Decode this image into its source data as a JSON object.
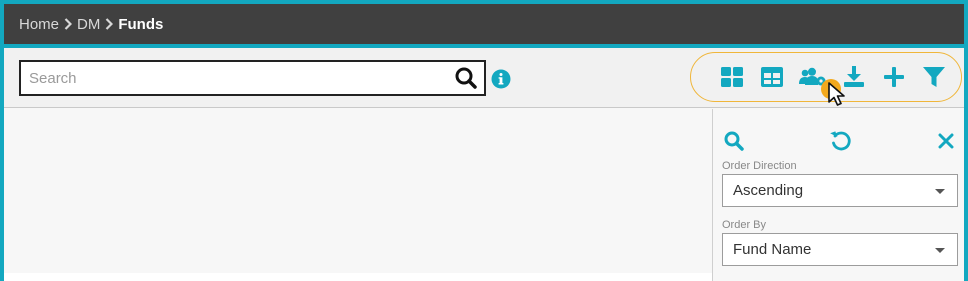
{
  "breadcrumb": {
    "items": [
      "Home",
      "DM"
    ],
    "current": "Funds"
  },
  "search": {
    "placeholder": "Search",
    "value": ""
  },
  "icons": {
    "search": "search-icon",
    "info": "info-icon",
    "grid_view": "grid-view-icon",
    "table_view": "table-view-icon",
    "group_settings": "group-settings-icon",
    "download": "download-icon",
    "add": "plus-icon",
    "filter": "filter-icon",
    "panel_search": "search-icon",
    "reset": "reset-icon",
    "close": "close-icon"
  },
  "filter_panel": {
    "order_direction": {
      "label": "Order Direction",
      "value": "Ascending"
    },
    "order_by": {
      "label": "Order By",
      "value": "Fund Name"
    }
  },
  "colors": {
    "accent": "#13a8c0",
    "header_bg": "#404040",
    "highlight": "#f3a91d",
    "group_border": "#f0b63a"
  }
}
